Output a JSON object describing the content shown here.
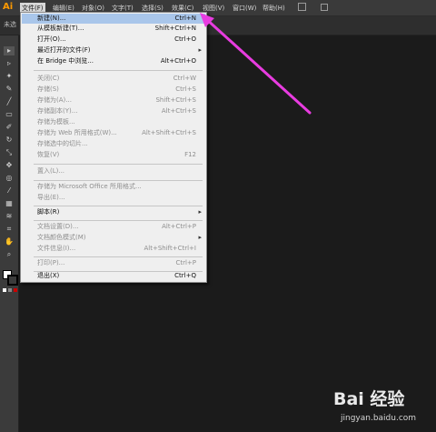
{
  "app": {
    "logo": "Ai"
  },
  "menubar": {
    "items": [
      {
        "label": "文件(F)",
        "active": true
      },
      {
        "label": "编辑(E)"
      },
      {
        "label": "对象(O)"
      },
      {
        "label": "文字(T)"
      },
      {
        "label": "选择(S)"
      },
      {
        "label": "效果(C)"
      },
      {
        "label": "视图(V)"
      },
      {
        "label": "窗口(W)"
      },
      {
        "label": "帮助(H)"
      }
    ]
  },
  "ctrlbar": {
    "label": "未选"
  },
  "file_menu": {
    "items": [
      {
        "label": "新建(N)...",
        "shortcut": "Ctrl+N",
        "highlight": true
      },
      {
        "label": "从模板新建(T)...",
        "shortcut": "Shift+Ctrl+N"
      },
      {
        "label": "打开(O)...",
        "shortcut": "Ctrl+O"
      },
      {
        "label": "最近打开的文件(F)",
        "shortcut": "",
        "submenu": true
      },
      {
        "label": "在 Bridge 中浏览...",
        "shortcut": "Alt+Ctrl+O"
      },
      {
        "sep": true
      },
      {
        "label": "关闭(C)",
        "shortcut": "Ctrl+W",
        "disabled": true
      },
      {
        "label": "存储(S)",
        "shortcut": "Ctrl+S",
        "disabled": true
      },
      {
        "label": "存储为(A)...",
        "shortcut": "Shift+Ctrl+S",
        "disabled": true
      },
      {
        "label": "存储副本(Y)...",
        "shortcut": "Alt+Ctrl+S",
        "disabled": true
      },
      {
        "label": "存储为模板...",
        "shortcut": "",
        "disabled": true
      },
      {
        "label": "存储为 Web 所用格式(W)...",
        "shortcut": "Alt+Shift+Ctrl+S",
        "disabled": true
      },
      {
        "label": "存储选中的切片...",
        "shortcut": "",
        "disabled": true
      },
      {
        "label": "恢复(V)",
        "shortcut": "F12",
        "disabled": true
      },
      {
        "sep": true
      },
      {
        "label": "置入(L)...",
        "shortcut": "",
        "disabled": true
      },
      {
        "sep": true
      },
      {
        "label": "存储为 Microsoft Office 所用格式...",
        "shortcut": "",
        "disabled": true
      },
      {
        "label": "导出(E)...",
        "shortcut": "",
        "disabled": true
      },
      {
        "sep": true
      },
      {
        "label": "脚本(R)",
        "shortcut": "",
        "submenu": true
      },
      {
        "sep": true
      },
      {
        "label": "文档设置(D)...",
        "shortcut": "Alt+Ctrl+P",
        "disabled": true
      },
      {
        "label": "文档颜色模式(M)",
        "shortcut": "",
        "submenu": true,
        "disabled": true
      },
      {
        "label": "文件信息(I)...",
        "shortcut": "Alt+Shift+Ctrl+I",
        "disabled": true
      },
      {
        "sep": true
      },
      {
        "label": "打印(P)...",
        "shortcut": "Ctrl+P",
        "disabled": true
      },
      {
        "sep": true
      },
      {
        "label": "退出(X)",
        "shortcut": "Ctrl+Q"
      }
    ]
  },
  "tools": [
    "▸",
    "▹",
    "✦",
    "✎",
    "╱",
    "▭",
    "✐",
    "↻",
    "⤡",
    "✥",
    "◎",
    "⁄",
    "▦",
    "≋",
    "⌗",
    "✋",
    "⌕"
  ],
  "colors": {
    "accent_arrow": "#e83ce0",
    "logo": "#ff9a00",
    "highlight": "#a9c6ea"
  },
  "watermark": {
    "text": "Bai 经验",
    "sub": "jingyan.baidu.com"
  }
}
